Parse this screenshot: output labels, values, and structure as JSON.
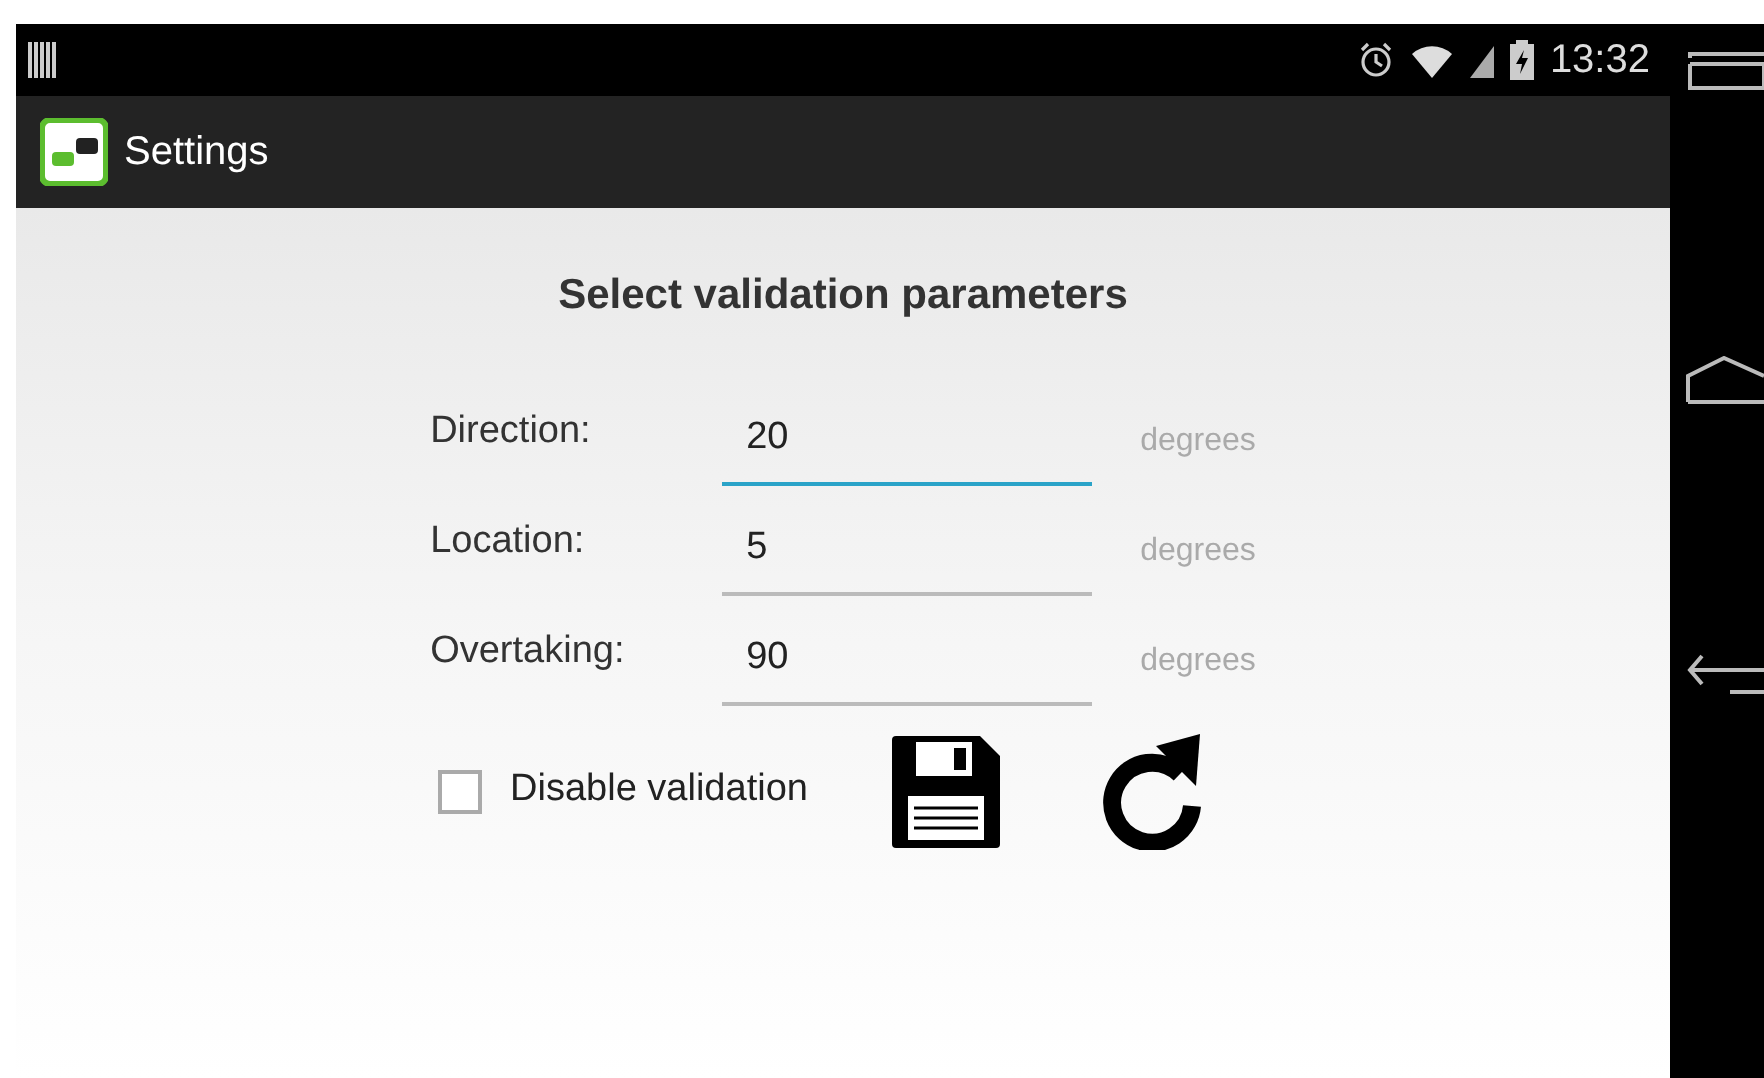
{
  "status_bar": {
    "time": "13:32"
  },
  "action_bar": {
    "title": "Settings"
  },
  "heading": "Select validation parameters",
  "fields": [
    {
      "label": "Direction:",
      "value": "20",
      "unit": "degrees",
      "focused": true
    },
    {
      "label": "Location:",
      "value": "5",
      "unit": "degrees",
      "focused": false
    },
    {
      "label": "Overtaking:",
      "value": "90",
      "unit": "degrees",
      "focused": false
    }
  ],
  "disable_validation": {
    "label": "Disable validation",
    "checked": false
  }
}
